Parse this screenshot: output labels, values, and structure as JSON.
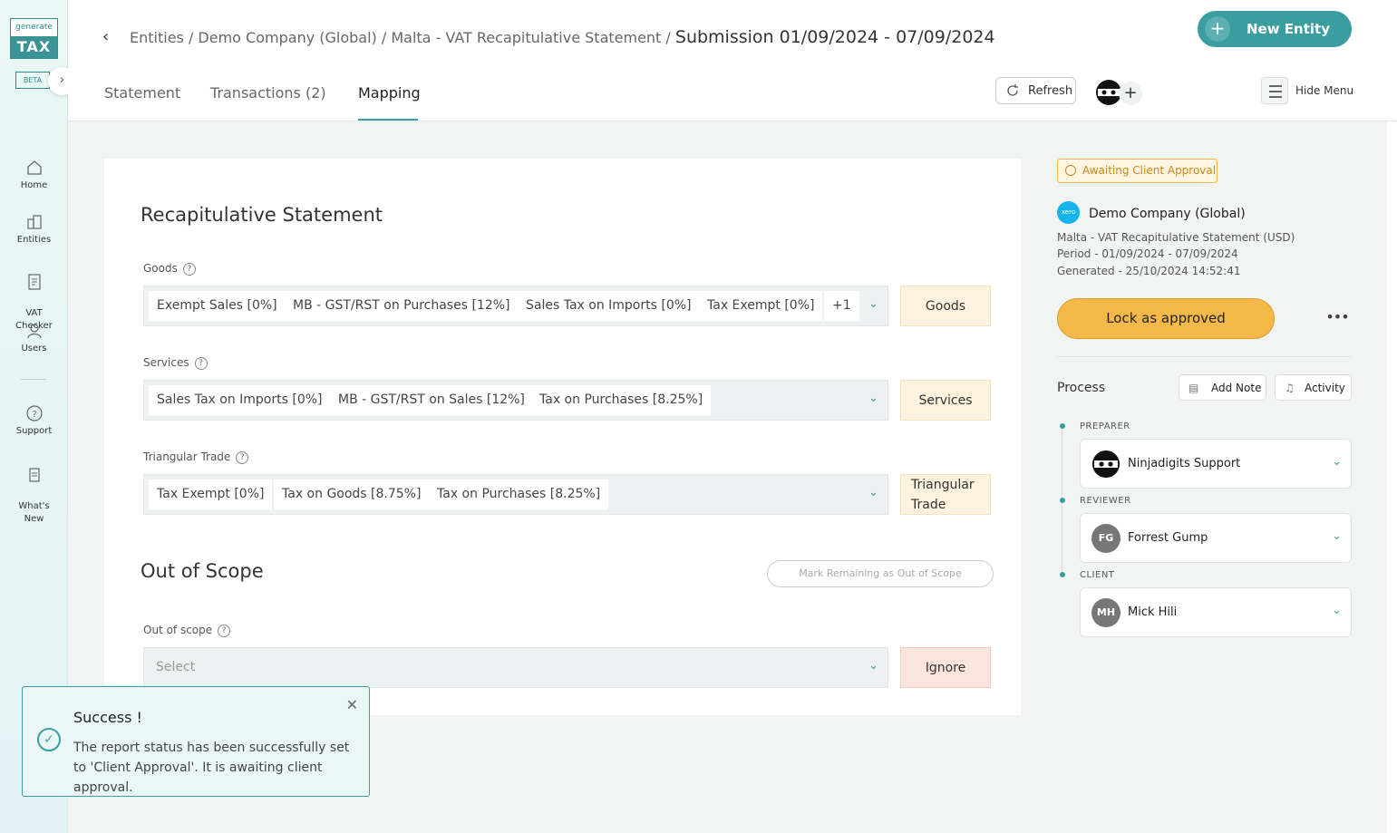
{
  "brand": {
    "logo_top": "generate",
    "logo_bottom": "TAX",
    "beta": "BETA"
  },
  "sidebar": {
    "items": [
      {
        "label": "Home",
        "icon": "home-icon"
      },
      {
        "label": "Entities",
        "icon": "building-icon"
      },
      {
        "label": "VAT\nChecker",
        "icon": "document-icon"
      },
      {
        "label": "Users",
        "icon": "user-icon"
      },
      {
        "label": "Support",
        "icon": "question-icon"
      },
      {
        "label": "What's\nNew",
        "icon": "news-icon"
      }
    ]
  },
  "header": {
    "breadcrumb": "Entities / Demo Company (Global) / Malta - VAT Recapitulative Statement / ",
    "current": "Submission 01/09/2024 - 07/09/2024",
    "new_entity": "New Entity",
    "tabs": [
      "Statement",
      "Transactions (2)",
      "Mapping"
    ],
    "active_tab": "Mapping",
    "refresh": "Refresh",
    "hide_menu": "Hide Menu"
  },
  "main": {
    "title": "Recapitulative Statement",
    "goods": {
      "label": "Goods",
      "chips": [
        "Exempt Sales [0%]",
        "MB - GST/RST on Purchases [12%]",
        "Sales Tax on Imports [0%]",
        "Tax Exempt [0%]",
        "+1"
      ],
      "tag": "Goods"
    },
    "services": {
      "label": "Services",
      "chips": [
        "Sales Tax on Imports [0%]",
        "MB - GST/RST on Sales [12%]",
        "Tax on Purchases [8.25%]"
      ],
      "tag": "Services"
    },
    "triangular": {
      "label": "Triangular Trade",
      "chips": [
        "Tax Exempt [0%]",
        "Tax on Goods [8.75%]",
        "Tax on Purchases [8.25%]"
      ],
      "tag_line1": "Triangular",
      "tag_line2": "Trade"
    },
    "out_of_scope_title": "Out of Scope",
    "mark_remaining": "Mark Remaining as Out of Scope",
    "out_of_scope": {
      "label": "Out of scope",
      "placeholder": "Select",
      "tag": "Ignore"
    }
  },
  "panel": {
    "status": "Awaiting Client Approval",
    "xero_logo": "xero",
    "company": "Demo Company (Global)",
    "report": "Malta - VAT Recapitulative Statement (USD)",
    "period": "Period - 01/09/2024 - 07/09/2024",
    "generated": "Generated - 25/10/2024 14:52:41",
    "lock_button": "Lock as approved",
    "more": "•••",
    "process": "Process",
    "add_note": "Add Note",
    "activity": "Activity",
    "roles": [
      {
        "role": "PREPARER",
        "name": "Ninjadigits Support",
        "initials": ""
      },
      {
        "role": "REVIEWER",
        "name": "Forrest Gump",
        "initials": "FG"
      },
      {
        "role": "CLIENT",
        "name": "Mick Hili",
        "initials": "MH"
      }
    ]
  },
  "toast": {
    "title": "Success !",
    "message": "The report status has been successfully set to 'Client Approval'. It is awaiting client approval."
  },
  "colors": {
    "accent": "#3a9ea0",
    "lock": "#f4b949",
    "status": "#c9871a"
  }
}
